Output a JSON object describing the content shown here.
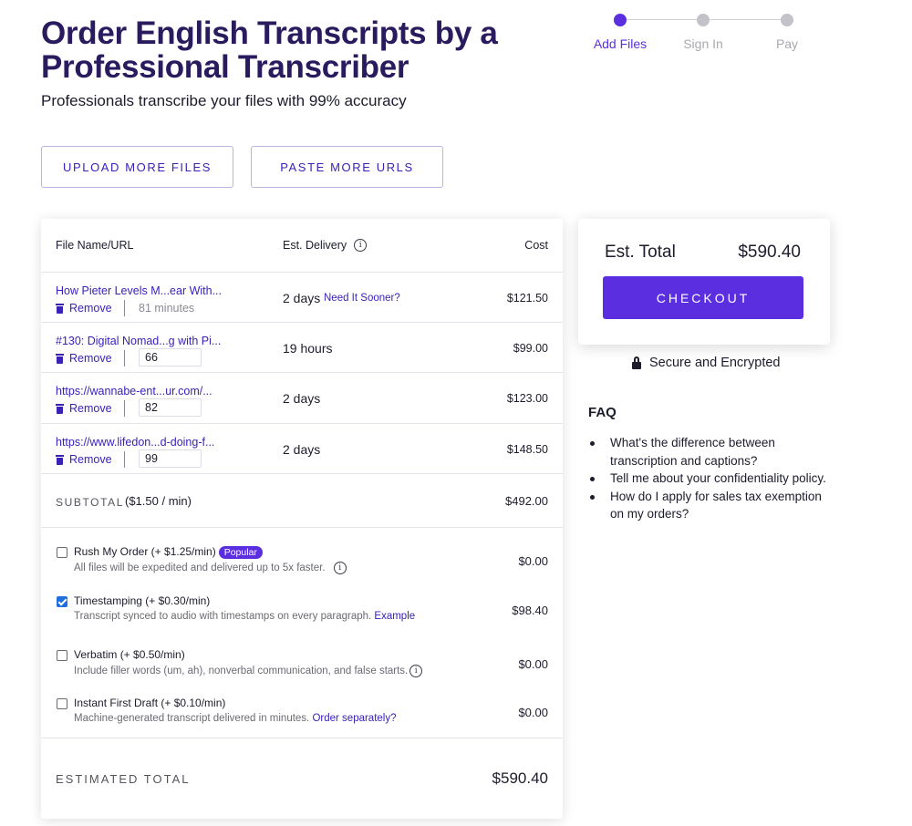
{
  "header": {
    "title": "Order English Transcripts by a Professional Transcriber",
    "subtitle": "Professionals transcribe your files with 99% accuracy"
  },
  "steps": [
    {
      "label": "Add Files",
      "active": true
    },
    {
      "label": "Sign In",
      "active": false
    },
    {
      "label": "Pay",
      "active": false
    }
  ],
  "actions": {
    "upload_label": "UPLOAD MORE FILES",
    "paste_label": "PASTE MORE URLS"
  },
  "table": {
    "columns": {
      "file": "File Name/URL",
      "delivery": "Est. Delivery",
      "cost": "Cost"
    },
    "remove_label": "Remove",
    "rows": [
      {
        "name": "How Pieter Levels M...ear With...",
        "minutes_text": "81 minutes",
        "delivery": "2 days",
        "sooner": "Need It Sooner?",
        "cost": "$121.50"
      },
      {
        "name": "#130: Digital Nomad...g with Pi...",
        "minutes": "66",
        "delivery": "19 hours",
        "cost": "$99.00"
      },
      {
        "name": "https://wannabe-ent...ur.com/...",
        "minutes": "82",
        "delivery": "2 days",
        "cost": "$123.00"
      },
      {
        "name": "https://www.lifedon...d-doing-f...",
        "minutes": "99",
        "delivery": "2 days",
        "cost": "$148.50"
      }
    ],
    "subtotal_label": "SUBTOTAL",
    "subtotal_rate": "($1.50 / min)",
    "subtotal_value": "$492.00"
  },
  "options": [
    {
      "title": "Rush My Order (+ $1.25/min)",
      "badge": "Popular",
      "desc": "All files will be expedited and delivered up to 5x faster.",
      "price": "$0.00",
      "checked": false
    },
    {
      "title": "Timestamping (+ $0.30/min)",
      "desc": "Transcript synced to audio with timestamps on every paragraph.",
      "link": "Example",
      "price": "$98.40",
      "checked": true
    },
    {
      "title": "Verbatim (+ $0.50/min)",
      "desc": "Include filler words (um, ah), nonverbal communication, and false starts.",
      "price": "$0.00",
      "checked": false
    },
    {
      "title": "Instant First Draft (+ $0.10/min)",
      "desc": "Machine-generated transcript delivered in minutes.",
      "link": "Order separately?",
      "price": "$0.00",
      "checked": false
    }
  ],
  "estimated": {
    "label": "ESTIMATED TOTAL",
    "value": "$590.40"
  },
  "summary": {
    "label": "Est. Total",
    "value": "$590.40",
    "checkout_label": "CHECKOUT",
    "secure_text": "Secure and Encrypted"
  },
  "faq": {
    "title": "FAQ",
    "items": [
      "What's the difference between transcription and captions?",
      "Tell me about your confidentiality policy.",
      "How do I apply for sales tax exemption on my orders?"
    ]
  },
  "colors": {
    "accent": "#5b2ee0",
    "heading": "#2a1a5e",
    "link": "#3b21b8",
    "checkbox": "#1f6fe0"
  },
  "icons": [
    "trash-icon",
    "info-icon",
    "lock-icon",
    "checkbox-icon"
  ]
}
